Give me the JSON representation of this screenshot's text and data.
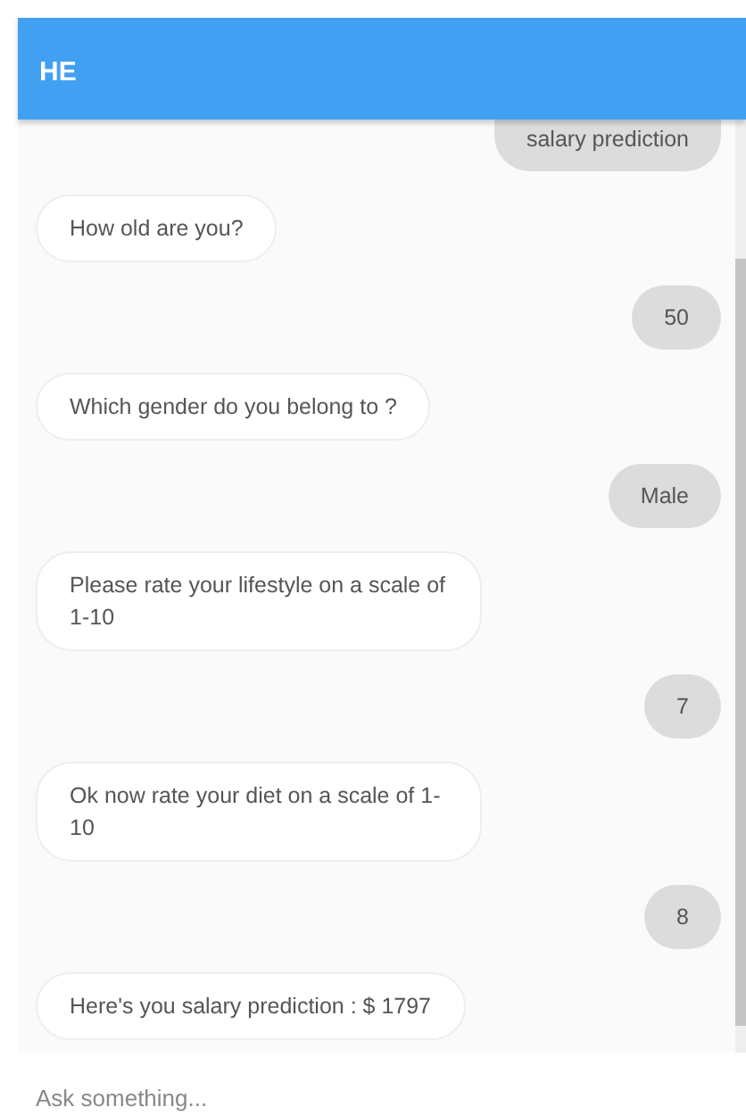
{
  "header": {
    "title": "HE"
  },
  "messages": [
    {
      "kind": "user",
      "text": "salary prediction"
    },
    {
      "kind": "bot",
      "text": "How old are you?"
    },
    {
      "kind": "user",
      "text": "50"
    },
    {
      "kind": "bot",
      "text": "Which gender do you belong to ?"
    },
    {
      "kind": "user",
      "text": "Male"
    },
    {
      "kind": "bot",
      "text": "Please rate your lifestyle on a scale of 1-10"
    },
    {
      "kind": "user",
      "text": "7"
    },
    {
      "kind": "bot",
      "text": "Ok now rate your diet on a scale of 1-10"
    },
    {
      "kind": "user",
      "text": "8"
    },
    {
      "kind": "bot",
      "text": "Here's you salary prediction : $ 1797"
    }
  ],
  "input": {
    "placeholder": "Ask something..."
  }
}
